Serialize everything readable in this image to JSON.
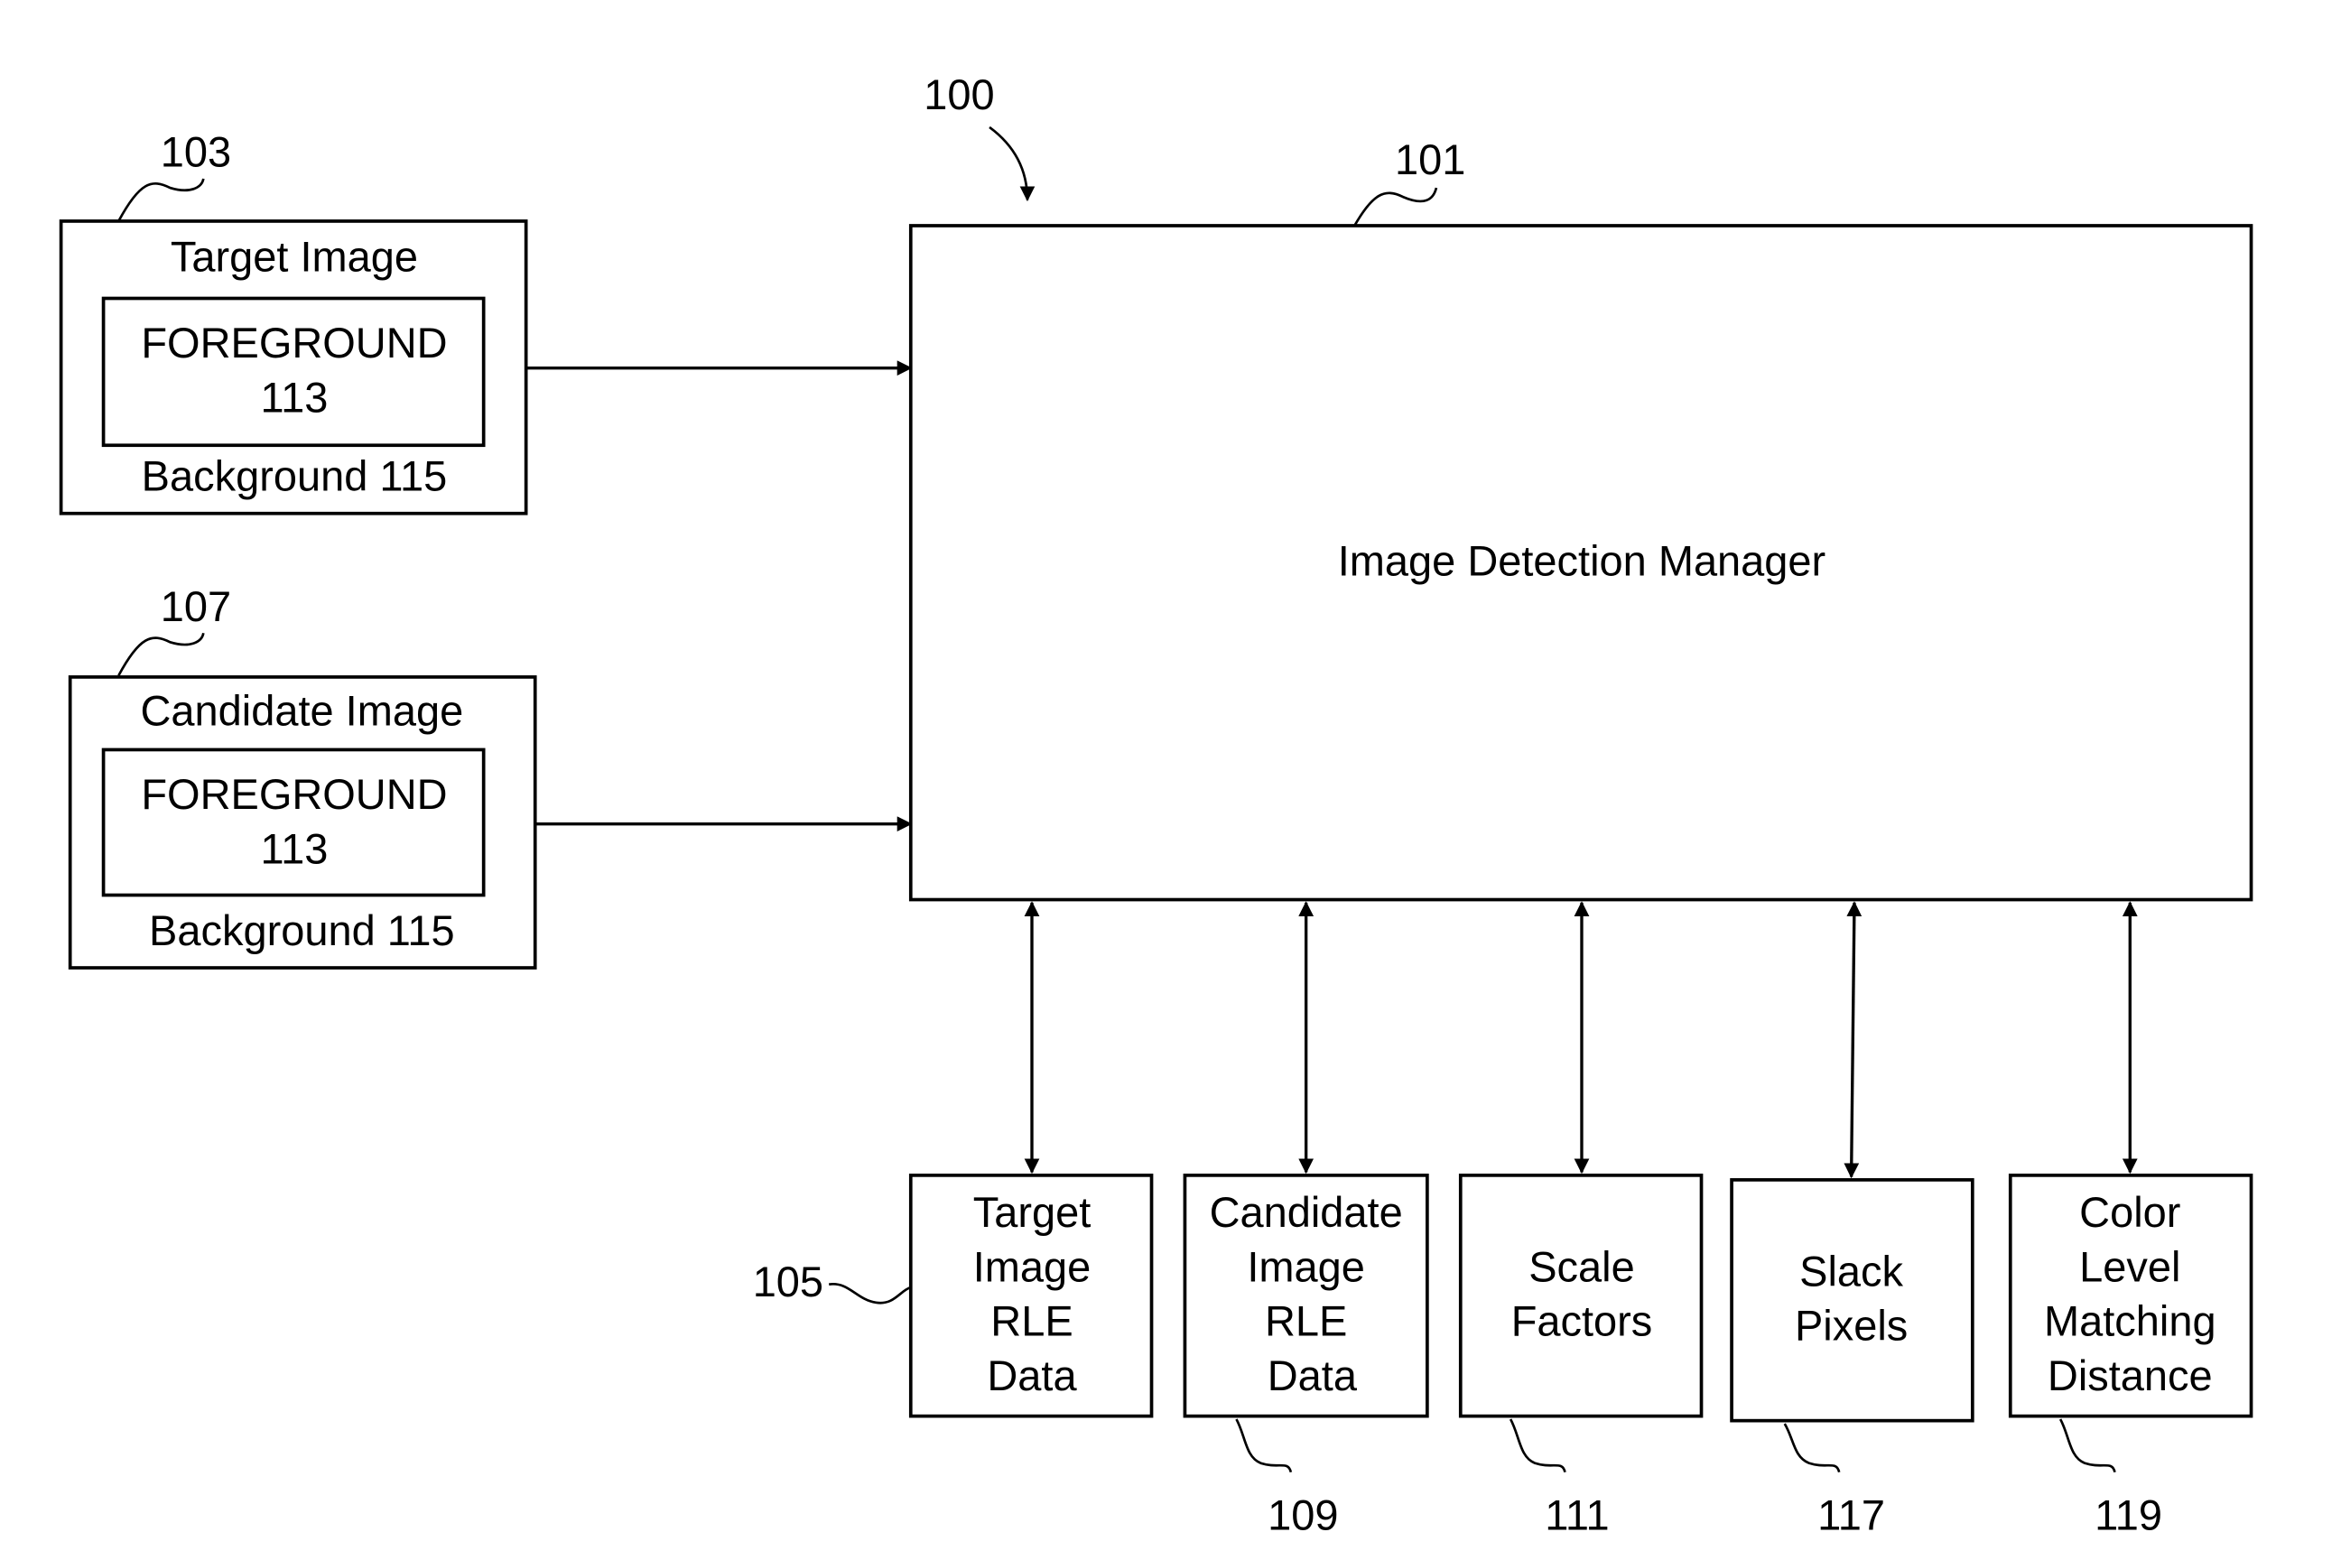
{
  "diagram": {
    "figure_ref": "100",
    "manager": {
      "ref": "101",
      "label": "Image Detection Manager"
    },
    "target_image": {
      "ref": "103",
      "title": "Target Image",
      "foreground": [
        "FOREGROUND",
        "113"
      ],
      "background": "Background 115"
    },
    "candidate_image": {
      "ref": "107",
      "title": "Candidate Image",
      "foreground": [
        "FOREGROUND",
        "113"
      ],
      "background": "Background 115"
    },
    "data_blocks": [
      {
        "ref": "105",
        "lines": [
          "Target",
          "Image",
          "RLE",
          "Data"
        ]
      },
      {
        "ref": "109",
        "lines": [
          "Candidate",
          "Image",
          "RLE",
          "Data"
        ]
      },
      {
        "ref": "111",
        "lines": [
          "Scale",
          "Factors"
        ]
      },
      {
        "ref": "117",
        "lines": [
          "Slack",
          "Pixels"
        ]
      },
      {
        "ref": "119",
        "lines": [
          "Color",
          "Level",
          "Matching",
          "Distance"
        ]
      }
    ]
  }
}
